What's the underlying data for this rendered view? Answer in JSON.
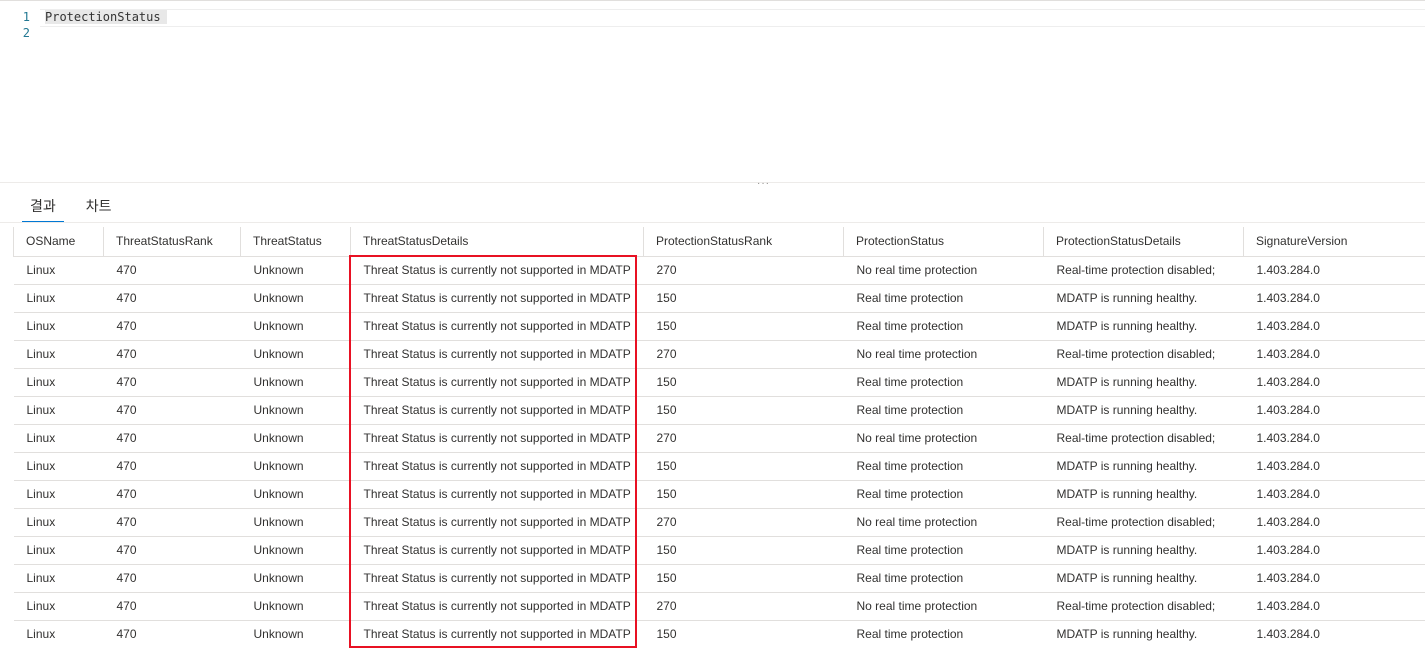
{
  "editor": {
    "lines": [
      {
        "number": "1",
        "text": "ProtectionStatus"
      },
      {
        "number": "2",
        "text": ""
      }
    ]
  },
  "splitter_grip": "···",
  "tabs": [
    {
      "label": "결과",
      "active": true
    },
    {
      "label": "차트",
      "active": false
    }
  ],
  "table": {
    "columns": [
      "OSName",
      "ThreatStatusRank",
      "ThreatStatus",
      "ThreatStatusDetails",
      "ProtectionStatusRank",
      "ProtectionStatus",
      "ProtectionStatusDetails",
      "SignatureVersion"
    ],
    "rows": [
      [
        "Linux",
        "470",
        "Unknown",
        "Threat Status is currently not supported in MDATP",
        "270",
        "No real time protection",
        "Real-time protection disabled;",
        "1.403.284.0"
      ],
      [
        "Linux",
        "470",
        "Unknown",
        "Threat Status is currently not supported in MDATP",
        "150",
        "Real time protection",
        "MDATP is running healthy.",
        "1.403.284.0"
      ],
      [
        "Linux",
        "470",
        "Unknown",
        "Threat Status is currently not supported in MDATP",
        "150",
        "Real time protection",
        "MDATP is running healthy.",
        "1.403.284.0"
      ],
      [
        "Linux",
        "470",
        "Unknown",
        "Threat Status is currently not supported in MDATP",
        "270",
        "No real time protection",
        "Real-time protection disabled;",
        "1.403.284.0"
      ],
      [
        "Linux",
        "470",
        "Unknown",
        "Threat Status is currently not supported in MDATP",
        "150",
        "Real time protection",
        "MDATP is running healthy.",
        "1.403.284.0"
      ],
      [
        "Linux",
        "470",
        "Unknown",
        "Threat Status is currently not supported in MDATP",
        "150",
        "Real time protection",
        "MDATP is running healthy.",
        "1.403.284.0"
      ],
      [
        "Linux",
        "470",
        "Unknown",
        "Threat Status is currently not supported in MDATP",
        "270",
        "No real time protection",
        "Real-time protection disabled;",
        "1.403.284.0"
      ],
      [
        "Linux",
        "470",
        "Unknown",
        "Threat Status is currently not supported in MDATP",
        "150",
        "Real time protection",
        "MDATP is running healthy.",
        "1.403.284.0"
      ],
      [
        "Linux",
        "470",
        "Unknown",
        "Threat Status is currently not supported in MDATP",
        "150",
        "Real time protection",
        "MDATP is running healthy.",
        "1.403.284.0"
      ],
      [
        "Linux",
        "470",
        "Unknown",
        "Threat Status is currently not supported in MDATP",
        "270",
        "No real time protection",
        "Real-time protection disabled;",
        "1.403.284.0"
      ],
      [
        "Linux",
        "470",
        "Unknown",
        "Threat Status is currently not supported in MDATP",
        "150",
        "Real time protection",
        "MDATP is running healthy.",
        "1.403.284.0"
      ],
      [
        "Linux",
        "470",
        "Unknown",
        "Threat Status is currently not supported in MDATP",
        "150",
        "Real time protection",
        "MDATP is running healthy.",
        "1.403.284.0"
      ],
      [
        "Linux",
        "470",
        "Unknown",
        "Threat Status is currently not supported in MDATP",
        "270",
        "No real time protection",
        "Real-time protection disabled;",
        "1.403.284.0"
      ],
      [
        "Linux",
        "470",
        "Unknown",
        "Threat Status is currently not supported in MDATP",
        "150",
        "Real time protection",
        "MDATP is running healthy.",
        "1.403.284.0"
      ]
    ]
  },
  "colors": {
    "highlight_box": "#e81123",
    "active_tab_underline": "#0078d4",
    "line_number": "#237893"
  }
}
